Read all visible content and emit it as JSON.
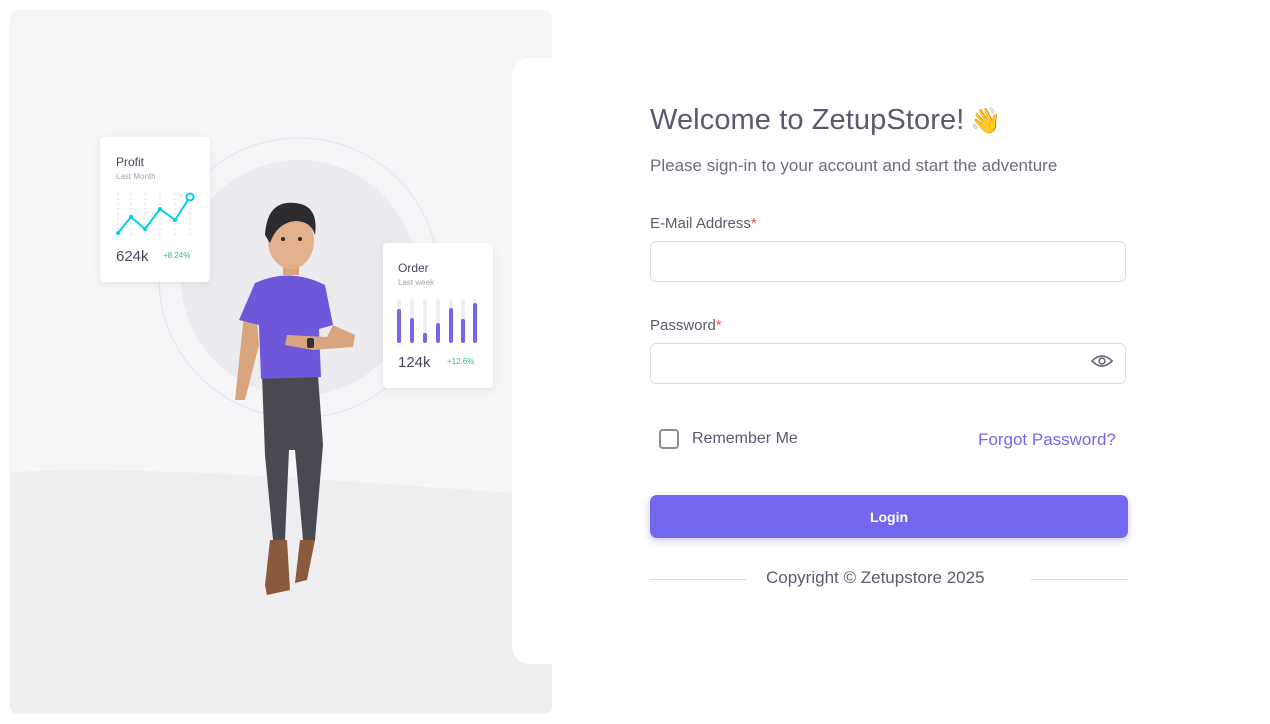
{
  "profit_card": {
    "title": "Profit",
    "subtitle": "Last Month",
    "value": "624k",
    "change": "+8.24%"
  },
  "order_card": {
    "title": "Order",
    "subtitle": "Last week",
    "value": "124k",
    "change": "+12.6%"
  },
  "login": {
    "title": "Welcome to ZetupStore!",
    "title_emoji": "👋",
    "subtitle": "Please sign-in to your account and start the adventure",
    "email_label": "E-Mail Address",
    "email_value": "",
    "password_label": "Password",
    "password_value": "",
    "required_mark": "*",
    "remember_label": "Remember Me",
    "remember_checked": false,
    "forgot_label": "Forgot Password?",
    "button_label": "Login",
    "copyright": "Copyright © Zetupstore 2025"
  },
  "colors": {
    "primary": "#7367f0",
    "success": "#28c76f",
    "chart_line": "#00cfe8",
    "danger": "#ea5455"
  },
  "icons": {
    "password_toggle": "eye-icon",
    "greeting": "waving-hand-emoji"
  }
}
